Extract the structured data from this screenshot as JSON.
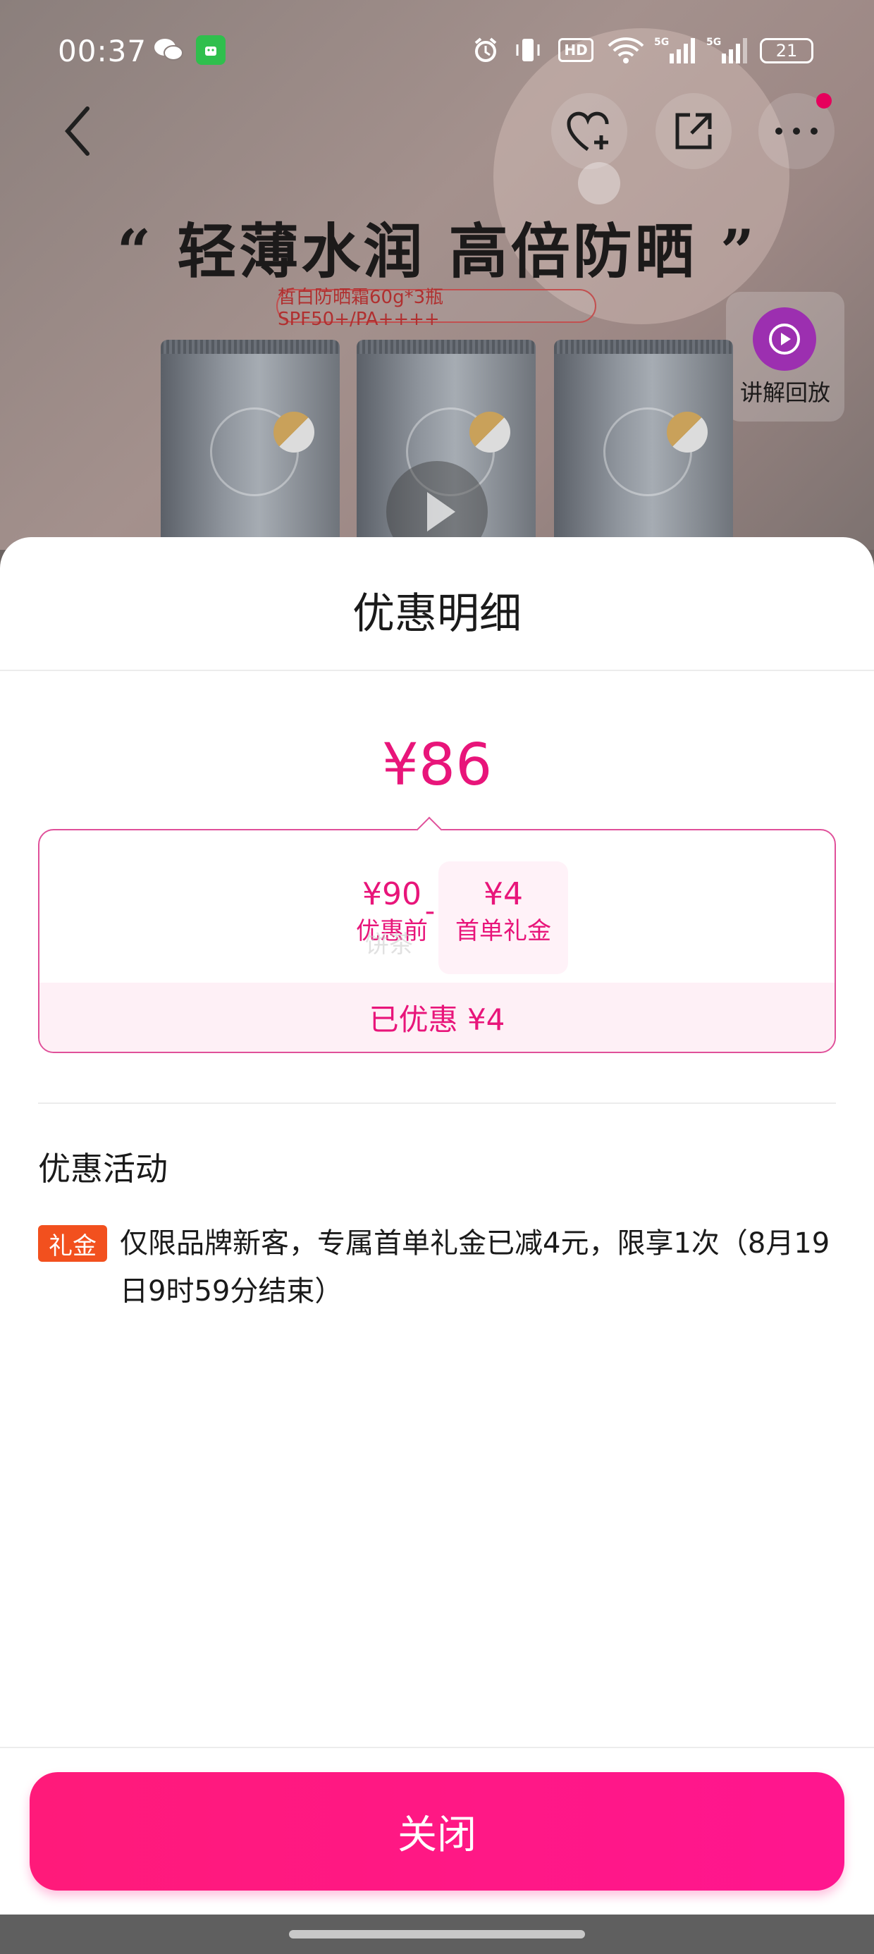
{
  "status_bar": {
    "time": "00:37",
    "hd_label": "HD",
    "signal_1": "5G",
    "signal_2": "5G",
    "battery": "21",
    "icons": [
      "wechat-icon",
      "app-icon",
      "alarm-icon",
      "vibrate-icon",
      "hd-icon",
      "wifi-icon",
      "signal-5g-icon",
      "signal-5g-icon",
      "battery-icon"
    ]
  },
  "header": {
    "icons": [
      "back-icon",
      "favorite-add-icon",
      "share-icon",
      "more-icon"
    ]
  },
  "product_banner": {
    "slogan": "“ 轻薄水润 高倍防晒 ”",
    "subtitle": "皙白防晒霜60g*3瓶SPF50+/PA++++",
    "replay_label": "讲解回放"
  },
  "sheet": {
    "title": "优惠明细",
    "final_price": "¥86",
    "breakdown": {
      "original_amount": "¥90",
      "original_label": "优惠前",
      "operator": "-",
      "gift_amount": "¥4",
      "gift_label": "首单礼金",
      "saved_text": "已优惠 ¥4"
    },
    "watermark": "饼茶",
    "activities_title": "优惠活动",
    "activities": [
      {
        "badge": "礼金",
        "description": "仅限品牌新客，专属首单礼金已减4元，限享1次（8月19日9时59分结束）"
      }
    ],
    "close_label": "关闭"
  },
  "colors": {
    "accent": "#e8157a",
    "button": "#ff1a7a",
    "badge": "#f2501e"
  }
}
